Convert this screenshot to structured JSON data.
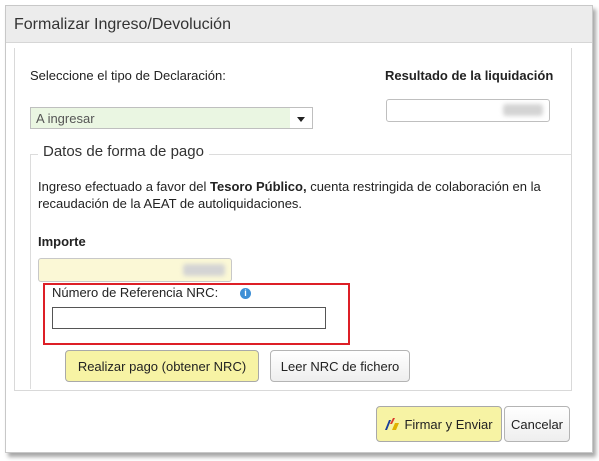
{
  "dialog": {
    "title": "Formalizar Ingreso/Devolución"
  },
  "declaration": {
    "label": "Seleccione el tipo de Declaración:",
    "selected": "A ingresar"
  },
  "result": {
    "label": "Resultado de la liquidación"
  },
  "payment": {
    "legend": "Datos de forma de pago",
    "info_prefix": "Ingreso efectuado a favor del ",
    "info_bold": "Tesoro Público,",
    "info_suffix": " cuenta restringida de colaboración en la recaudación de la AEAT de autoliquidaciones.",
    "importe_label": "Importe",
    "nrc_label": "Número de Referencia  NRC:",
    "nrc_value": ""
  },
  "buttons": {
    "pay": "Realizar pago (obtener NRC)",
    "read_file": "Leer NRC de fichero",
    "sign": "Firmar y Enviar",
    "cancel": "Cancelar"
  },
  "icons": {
    "info": "info-icon",
    "sign": "signature-icon",
    "dropdown": "chevron-down-icon"
  },
  "colors": {
    "highlight_frame": "#dd1f26",
    "primary_button_bg": "#f7f3a4",
    "select_bg": "#eaf6e2",
    "importe_bg": "#fbf8d6"
  }
}
